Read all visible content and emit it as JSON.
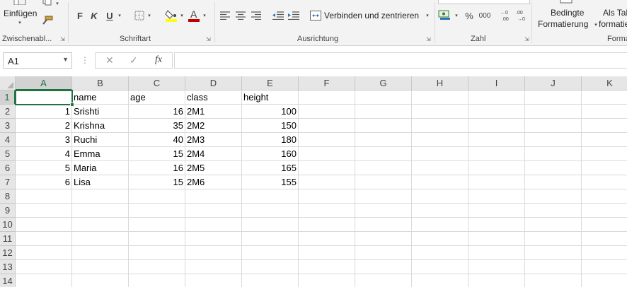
{
  "ribbon": {
    "paste_label": "Einfügen",
    "clipboard_label": "Zwischenabl...",
    "font_label": "Schriftart",
    "bold": "F",
    "italic": "K",
    "underline": "U",
    "alignment_label": "Ausrichtung",
    "merge_label": "Verbinden und zentrieren",
    "number_label": "Zahl",
    "percent": "%",
    "thousands": "000",
    "cond_format_line1": "Bedingte",
    "cond_format_line2": "Formatierung",
    "table_format_line1": "Als Tal",
    "table_format_line2": "formatie",
    "styles_label": "Forma",
    "font_color": "#c00000",
    "highlight_color": "#ffff00"
  },
  "formula_bar": {
    "name_box": "A1",
    "fx": "fx",
    "cancel": "✕",
    "enter": "✓",
    "content": ""
  },
  "sheet": {
    "columns": [
      "A",
      "B",
      "C",
      "D",
      "E",
      "F",
      "G",
      "H",
      "I",
      "J",
      "K"
    ],
    "rows": [
      "1",
      "2",
      "3",
      "4",
      "5",
      "6",
      "7",
      "8",
      "9",
      "10",
      "11",
      "12",
      "13",
      "14"
    ],
    "headers": {
      "b": "name",
      "c": "age",
      "d": "class",
      "e": "height"
    },
    "data": [
      {
        "a": "1",
        "b": "Srishti",
        "c": "16",
        "d": "2M1",
        "e": "100"
      },
      {
        "a": "2",
        "b": "Krishna",
        "c": "35",
        "d": "2M2",
        "e": "150"
      },
      {
        "a": "3",
        "b": "Ruchi",
        "c": "40",
        "d": "2M3",
        "e": "180"
      },
      {
        "a": "4",
        "b": "Emma",
        "c": "15",
        "d": "2M4",
        "e": "160"
      },
      {
        "a": "5",
        "b": "Maria",
        "c": "16",
        "d": "2M5",
        "e": "165"
      },
      {
        "a": "6",
        "b": "Lisa",
        "c": "15",
        "d": "2M6",
        "e": "155"
      }
    ],
    "accent": "#217346"
  }
}
